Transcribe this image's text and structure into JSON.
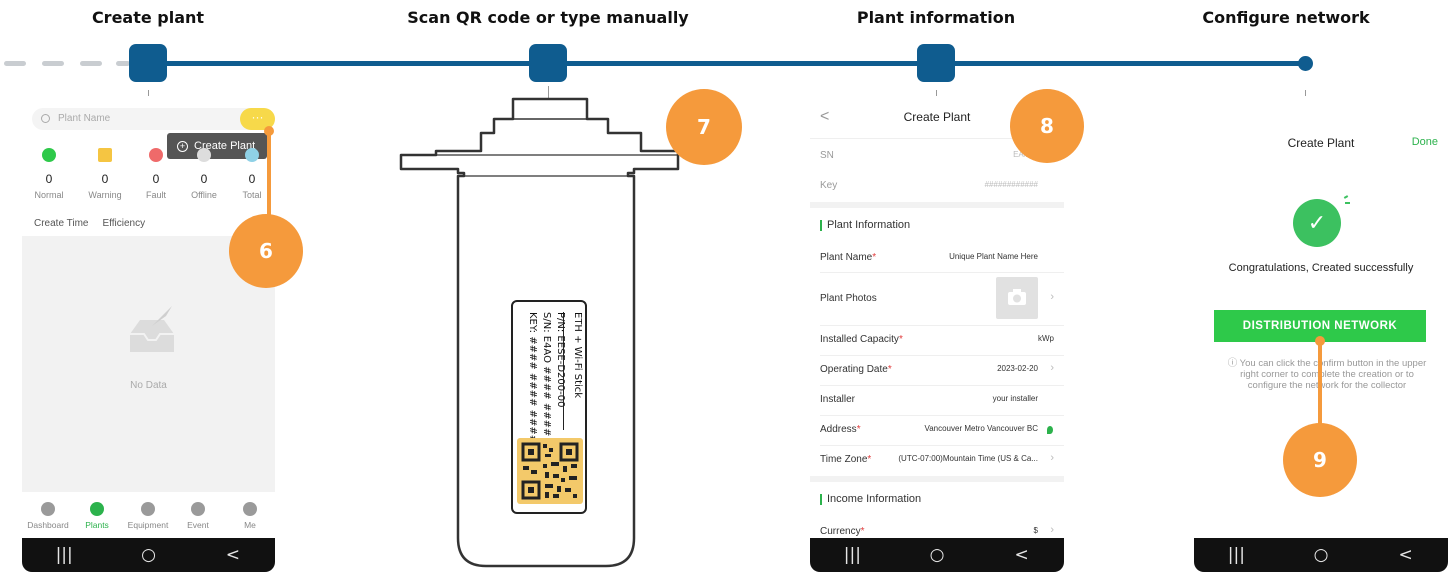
{
  "steps": [
    {
      "title": "Create plant"
    },
    {
      "title": "Scan QR code or type manually"
    },
    {
      "title": "Plant information"
    },
    {
      "title": "Configure network"
    }
  ],
  "badges": [
    "6",
    "7",
    "8",
    "9"
  ],
  "colors": {
    "timeline": "#0f5c8f",
    "badge": "#f59a3c",
    "green": "#2cb24c"
  },
  "screen1": {
    "search_placeholder": "Plant Name",
    "more_label": "···",
    "popup_label": "Create Plant",
    "stats": [
      {
        "count": "0",
        "label": "Normal",
        "icon": "normal-status-icon",
        "color": "#2ec94a"
      },
      {
        "count": "0",
        "label": "Warning",
        "icon": "warning-status-icon",
        "color": "#f5c542"
      },
      {
        "count": "0",
        "label": "Fault",
        "icon": "fault-status-icon",
        "color": "#ef6a6a"
      },
      {
        "count": "0",
        "label": "Offline",
        "icon": "offline-status-icon",
        "color": "#dddddd"
      },
      {
        "count": "0",
        "label": "Total",
        "icon": "total-status-icon",
        "color": "#8fd1e6"
      }
    ],
    "sort": [
      "Create Time",
      "Efficiency"
    ],
    "empty_text": "No Data",
    "tabs": [
      "Dashboard",
      "Plants",
      "Equipment",
      "Event",
      "Me"
    ],
    "active_tab": "Plants"
  },
  "stick": {
    "lines": [
      "ETH + Wi-Fi Stick",
      "P/N: EESE-D200-00",
      "S/N: E4AO #### ####",
      "KEY: #### #### ####"
    ]
  },
  "screen3": {
    "back": "<",
    "title": "Create Plant",
    "sn_label": "SN",
    "sn_value": "EA#####",
    "key_label": "Key",
    "key_value": "############",
    "plant_section": "Plant Information",
    "rows": [
      {
        "label": "Plant Name",
        "value": "Unique Plant Name Here",
        "required": true
      },
      {
        "label": "Plant Photos",
        "value": "",
        "required": false
      },
      {
        "label": "Installed Capacity",
        "value": "kWp",
        "required": true
      },
      {
        "label": "Operating Date",
        "value": "2023-02-20",
        "required": true
      },
      {
        "label": "Installer",
        "value": "your installer",
        "required": false
      },
      {
        "label": "Address",
        "value": "Vancouver Metro Vancouver BC",
        "required": true
      },
      {
        "label": "Time Zone",
        "value": "(UTC-07:00)Mountain Time (US & Ca...",
        "required": true
      }
    ],
    "income_section": "Income Information",
    "currency_label": "Currency",
    "currency_value": "$"
  },
  "screen4": {
    "title": "Create Plant",
    "done": "Done",
    "congrats": "Congratulations, Created successfully",
    "button": "DISTRIBUTION NETWORK",
    "info": "You can click the confirm button in the upper right corner to complete the creation or to configure the network for the collector"
  },
  "system_nav": [
    "|||",
    "○",
    "<"
  ]
}
